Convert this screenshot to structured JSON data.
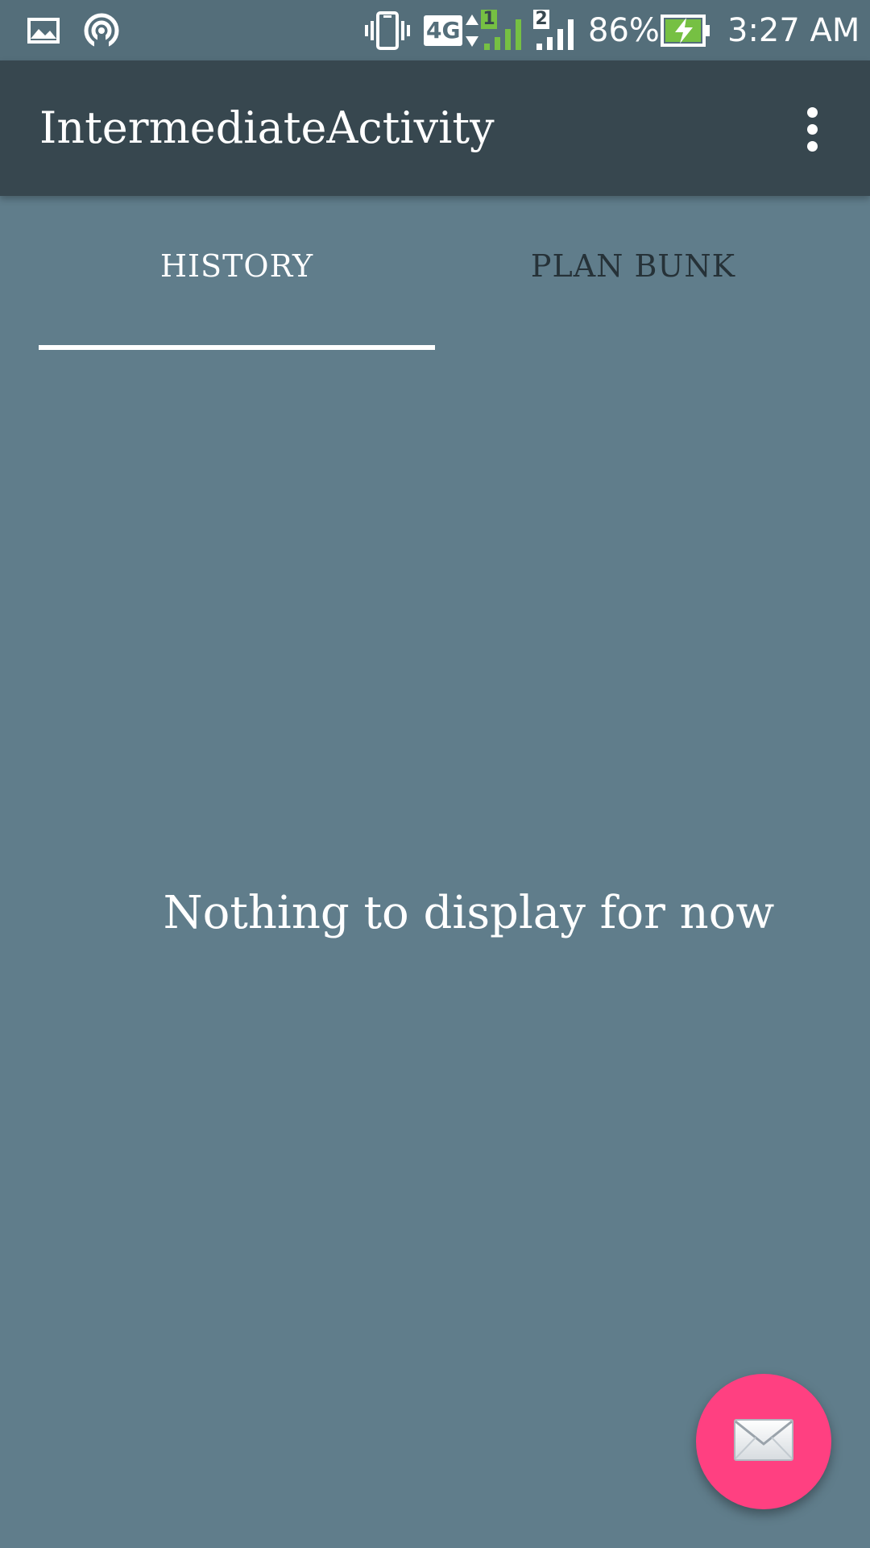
{
  "status_bar": {
    "network_type": "4G",
    "sim1_label": "1",
    "sim2_label": "2",
    "battery_percent": "86%",
    "time": "3:27 AM",
    "icons": [
      "image-notification-icon",
      "hotspot-icon",
      "vibrate-icon",
      "4g-data-icon",
      "signal-sim1-icon",
      "signal-sim2-icon",
      "battery-charging-icon"
    ]
  },
  "toolbar": {
    "title": "IntermediateActivity",
    "overflow_icon": "more-vert-icon"
  },
  "tabs": [
    {
      "label": "HISTORY",
      "selected": true
    },
    {
      "label": "PLAN BUNK",
      "selected": false
    }
  ],
  "content": {
    "empty_message": "Nothing to display for now"
  },
  "fab": {
    "icon": "envelope-icon"
  },
  "colors": {
    "status_bar": "#546e7a",
    "toolbar": "#37474f",
    "background": "#607d8b",
    "fab": "#ff4081",
    "tab_inactive_text": "#263238",
    "battery_fill": "#76c043"
  }
}
